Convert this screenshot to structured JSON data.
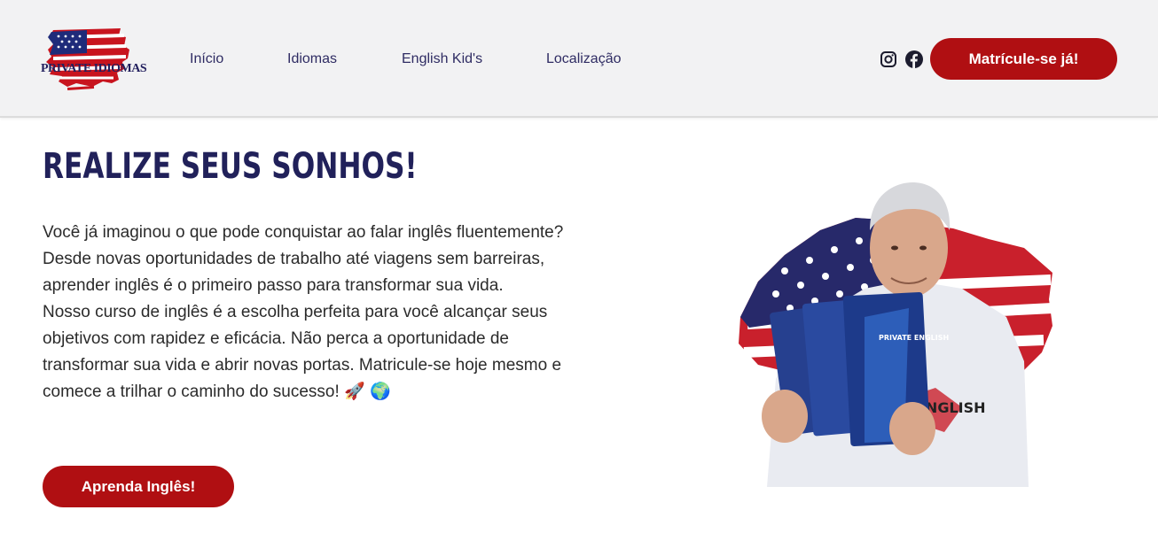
{
  "header": {
    "logo": {
      "text": "PRIVATE IDIOMAS",
      "icon": "us-flag-brush-logo"
    },
    "nav": [
      {
        "label": "Início"
      },
      {
        "label": "Idiomas"
      },
      {
        "label": "English Kid's"
      },
      {
        "label": "Localização"
      }
    ],
    "social": [
      {
        "icon": "instagram-icon"
      },
      {
        "icon": "facebook-icon"
      }
    ],
    "cta_label": "Matrícule-se já!"
  },
  "hero": {
    "title": "REALIZE SEUS SONHOS!",
    "paragraph_1": "Você já imaginou o que pode conquistar ao falar inglês fluentemente? Desde novas oportunidades de trabalho até viagens sem barreiras, aprender inglês é o primeiro passo para transformar sua vida.",
    "paragraph_2": "Nosso curso de inglês é a escolha perfeita para você alcançar seus objetivos com rapidez e eficácia. Não perca a oportunidade de transformar sua vida e abrir novas portas. Matricule-se hoje mesmo e comece a trilhar o caminho do sucesso! 🚀 🌍",
    "cta_label": "Aprenda Inglês!",
    "image": {
      "book_title": "PRIVATE ENGLISH",
      "shirt_text": "ENGLISH"
    }
  },
  "colors": {
    "brand_red": "#b00f12",
    "brand_navy": "#21215a",
    "header_bg": "#f2f2f3"
  }
}
